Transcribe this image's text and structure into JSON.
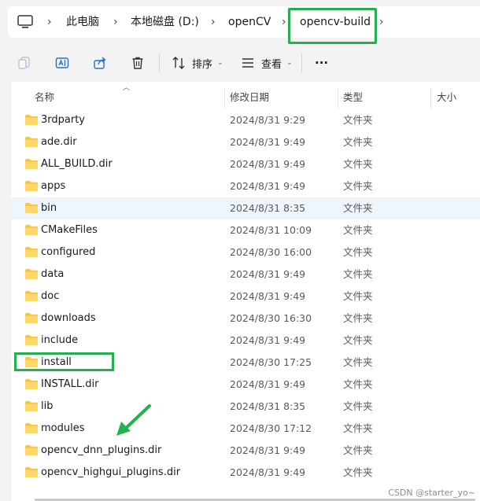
{
  "breadcrumb": {
    "items": [
      "此电脑",
      "本地磁盘 (D:)",
      "openCV",
      "opencv-build"
    ],
    "separator": "›"
  },
  "toolbar": {
    "sort_label": "排序",
    "view_label": "查看",
    "more_label": "···"
  },
  "columns": {
    "name": "名称",
    "modified": "修改日期",
    "type": "类型",
    "size": "大小"
  },
  "files": [
    {
      "name": "3rdparty",
      "modified": "2024/8/31 9:29",
      "type": "文件夹"
    },
    {
      "name": "ade.dir",
      "modified": "2024/8/31 9:49",
      "type": "文件夹"
    },
    {
      "name": "ALL_BUILD.dir",
      "modified": "2024/8/31 9:49",
      "type": "文件夹"
    },
    {
      "name": "apps",
      "modified": "2024/8/31 9:49",
      "type": "文件夹"
    },
    {
      "name": "bin",
      "modified": "2024/8/31 8:35",
      "type": "文件夹"
    },
    {
      "name": "CMakeFiles",
      "modified": "2024/8/31 10:09",
      "type": "文件夹"
    },
    {
      "name": "configured",
      "modified": "2024/8/30 16:00",
      "type": "文件夹"
    },
    {
      "name": "data",
      "modified": "2024/8/31 9:49",
      "type": "文件夹"
    },
    {
      "name": "doc",
      "modified": "2024/8/31 9:49",
      "type": "文件夹"
    },
    {
      "name": "downloads",
      "modified": "2024/8/30 16:30",
      "type": "文件夹"
    },
    {
      "name": "include",
      "modified": "2024/8/31 9:49",
      "type": "文件夹"
    },
    {
      "name": "install",
      "modified": "2024/8/30 17:25",
      "type": "文件夹"
    },
    {
      "name": "INSTALL.dir",
      "modified": "2024/8/31 9:49",
      "type": "文件夹"
    },
    {
      "name": "lib",
      "modified": "2024/8/31 8:35",
      "type": "文件夹"
    },
    {
      "name": "modules",
      "modified": "2024/8/30 17:12",
      "type": "文件夹"
    },
    {
      "name": "opencv_dnn_plugins.dir",
      "modified": "2024/8/31 9:49",
      "type": "文件夹"
    },
    {
      "name": "opencv_highgui_plugins.dir",
      "modified": "2024/8/31 9:49",
      "type": "文件夹"
    }
  ],
  "selected_file": "bin",
  "watermark": "CSDN @starter_yo~",
  "colors": {
    "highlight_annotation": "#22b14c",
    "folder": "#f8c84a",
    "selected_row": "#eef5fc"
  }
}
